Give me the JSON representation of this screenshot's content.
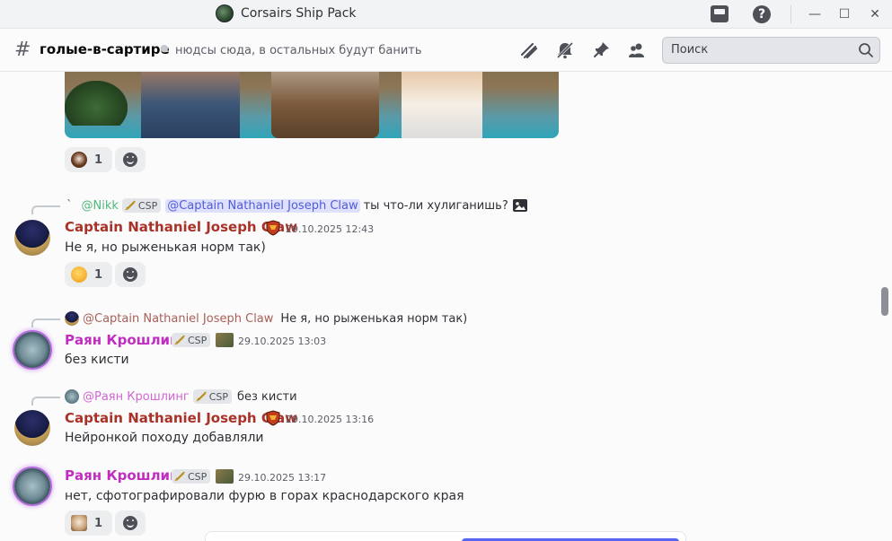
{
  "window": {
    "title": "Corsairs Ship Pack",
    "controls": {
      "minimize": "—",
      "maximize": "☐",
      "close": "✕"
    },
    "icons": [
      "inbox-icon",
      "help-icon"
    ]
  },
  "channel": {
    "hash": "#",
    "name": "голые-в-сартире",
    "topic": "нюдсы сюда, в остальных будут банить",
    "search_placeholder": "Поиск",
    "icons": [
      "threads-icon",
      "notifications-muted-icon",
      "pin-icon",
      "member-list-icon",
      "search-icon"
    ]
  },
  "colors": {
    "captain_name": "#a83228",
    "rayan_name": "#c02ec0",
    "nikk_name": "#4fb87a",
    "accent": "#5865f2"
  },
  "messages": [
    {
      "id": "img",
      "reaction": {
        "count": "1",
        "emoji": "horse-emoji"
      }
    },
    {
      "id": "m1",
      "reply": {
        "prefix": "`",
        "name": "@Nikk",
        "tag": "CSP",
        "mention": "@Captain Nathaniel Joseph Claw",
        "text": "ты что-ли хулиганишь?",
        "image_icon": "image-icon"
      },
      "author": "Captain Nathaniel Joseph Claw",
      "time": "29.10.2025 12:43",
      "content": "Не я, но рыженькая норм так)",
      "reaction": {
        "count": "1",
        "emoji": "shushing-face-emoji"
      }
    },
    {
      "id": "m2",
      "reply": {
        "name": "@Captain Nathaniel Joseph Claw",
        "text": "Не я, но рыженькая норм так)"
      },
      "author": "Раян Крошлинг",
      "tag": "CSP",
      "time": "29.10.2025 13:03",
      "content": "без кисти"
    },
    {
      "id": "m3",
      "reply": {
        "name": "@Раян Крошлинг",
        "tag": "CSP",
        "text": "без кисти"
      },
      "author": "Captain Nathaniel Joseph Claw",
      "time": "29.10.2025 13:16",
      "content": "Нейронкой походу добавляли"
    },
    {
      "id": "m4",
      "author": "Раян Крошлинг",
      "tag": "CSP",
      "time": "29.10.2025 13:17",
      "content": "нет, сфотографировали фурю в горах краснодарского края",
      "reaction": {
        "count": "1",
        "emoji": "dog-emoji"
      }
    }
  ]
}
